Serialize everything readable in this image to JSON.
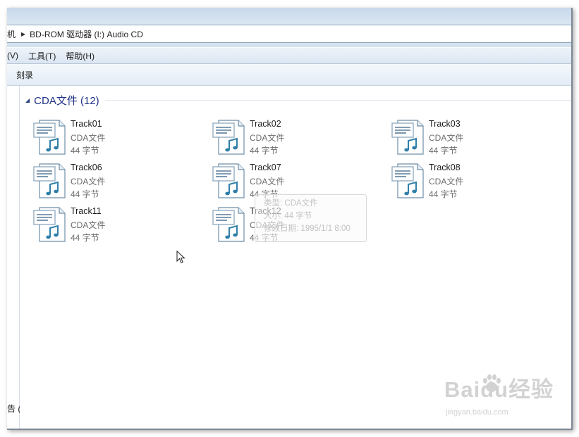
{
  "address": {
    "previous_crumb": "机",
    "path": "BD-ROM 驱动器 (I:) Audio CD"
  },
  "menu": {
    "view": "(V)",
    "tools": "工具(T)",
    "help": "帮助(H)"
  },
  "toolbar": {
    "burn": "刻录"
  },
  "navpane": {
    "drive_label": "告 (I:"
  },
  "group": {
    "title": "CDA文件 (12)"
  },
  "files": [
    {
      "name": "Track01",
      "type": "CDA文件",
      "size": "44 字节"
    },
    {
      "name": "Track02",
      "type": "CDA文件",
      "size": "44 字节"
    },
    {
      "name": "Track03",
      "type": "CDA文件",
      "size": "44 字节"
    },
    {
      "name": "Track06",
      "type": "CDA文件",
      "size": "44 字节"
    },
    {
      "name": "Track07",
      "type": "CDA文件",
      "size": "44 字节"
    },
    {
      "name": "Track08",
      "type": "CDA文件",
      "size": "44 字节"
    },
    {
      "name": "Track11",
      "type": "CDA文件",
      "size": "44 字节"
    },
    {
      "name": "Track12",
      "type": "CDA文件",
      "size": "44 字节"
    }
  ],
  "tooltip": {
    "type_line": "类型: CDA文件",
    "size_line": "大小: 44 字节",
    "date_line": "修改日期: 1995/1/1 8:00"
  },
  "watermark": {
    "brand": "Baidu经验",
    "url": "jingyan.baidu.com"
  },
  "colors": {
    "group_title": "#1e3287",
    "icon_accent": "#2f7fa8",
    "address_border": "#8ea4bd"
  },
  "icons": {
    "file": "audio-file-icon",
    "cursor": "mouse-pointer-icon"
  }
}
